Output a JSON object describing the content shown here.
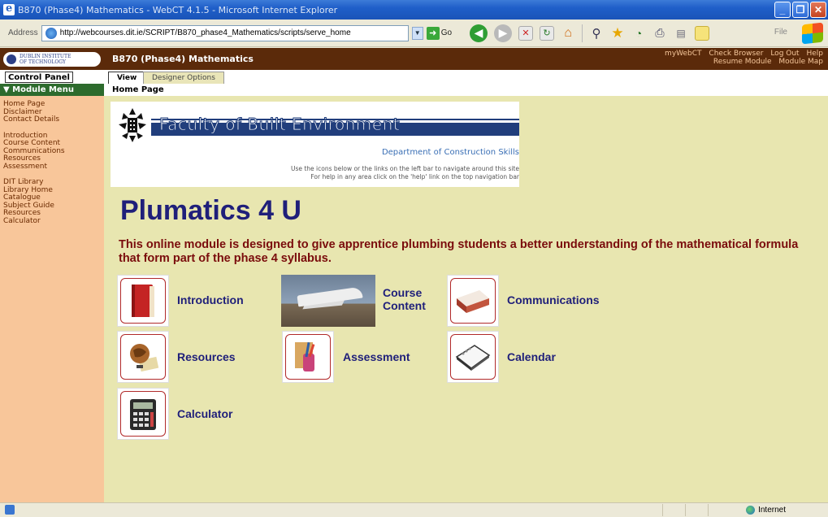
{
  "browser": {
    "title": "B870 (Phase4) Mathematics - WebCT 4.1.5 - Microsoft Internet Explorer",
    "address_label": "Address",
    "url": "http://webcourses.dit.ie/SCRIPT/B870_phase4_Mathematics/scripts/serve_home",
    "go_label": "Go",
    "file_label": "File",
    "status_zone": "Internet"
  },
  "header": {
    "logo_line1": "DUBLIN INSTITUTE",
    "logo_line2": "OF TECHNOLOGY",
    "module_title": "B870 (Phase4) Mathematics",
    "links_row1": [
      "myWebCT",
      "Check Browser",
      "Log Out",
      "Help"
    ],
    "links_row2": [
      "Resume Module",
      "Module Map"
    ]
  },
  "tabs": {
    "control_panel": "Control Panel",
    "view": "View",
    "designer": "Designer Options"
  },
  "menu": {
    "heading": "Module Menu",
    "breadcrumb": "Home Page",
    "group1": [
      "Home Page",
      "Disclaimer",
      "Contact Details"
    ],
    "group2": [
      "Introduction",
      "Course Content",
      "Communications",
      "Resources",
      "Assessment"
    ],
    "group3": [
      "DIT Library",
      "Library Home",
      "Catalogue",
      "Subject Guide",
      "Resources",
      "Calculator"
    ]
  },
  "banner": {
    "faculty": "Faculty of Built Environment",
    "department": "Department of Construction Skills",
    "help_line1": "Use the icons below or the links on the left bar to navigate around this site",
    "help_line2": "For help in any area click on the 'help' link on the top navigation bar"
  },
  "main": {
    "title": "Plumatics 4 U",
    "subtitle": "This online module is designed to give apprentice plumbing students a better understanding of the mathematical formula that form part of the phase 4 syllabus.",
    "links": {
      "introduction": "Introduction",
      "course_content_1": "Course",
      "course_content_2": "Content",
      "communications": "Communications",
      "resources": "Resources",
      "assessment": "Assessment",
      "calendar": "Calendar",
      "calculator": "Calculator"
    }
  },
  "icons": {
    "introduction": "book-icon",
    "course_content": "space-shuttle-image",
    "communications": "inbox-tray-icon",
    "resources": "globe-icon",
    "assessment": "pencils-icon",
    "calendar": "calendar-icon",
    "calculator": "calculator-icon"
  },
  "colors": {
    "header_brown": "#5b2a0a",
    "sidebar_orange": "#f8c69a",
    "content_bg": "#e8e6b0",
    "title_navy": "#1f1f7a",
    "subtitle_red": "#7a0c0c",
    "menu_green": "#2d6b2d"
  }
}
